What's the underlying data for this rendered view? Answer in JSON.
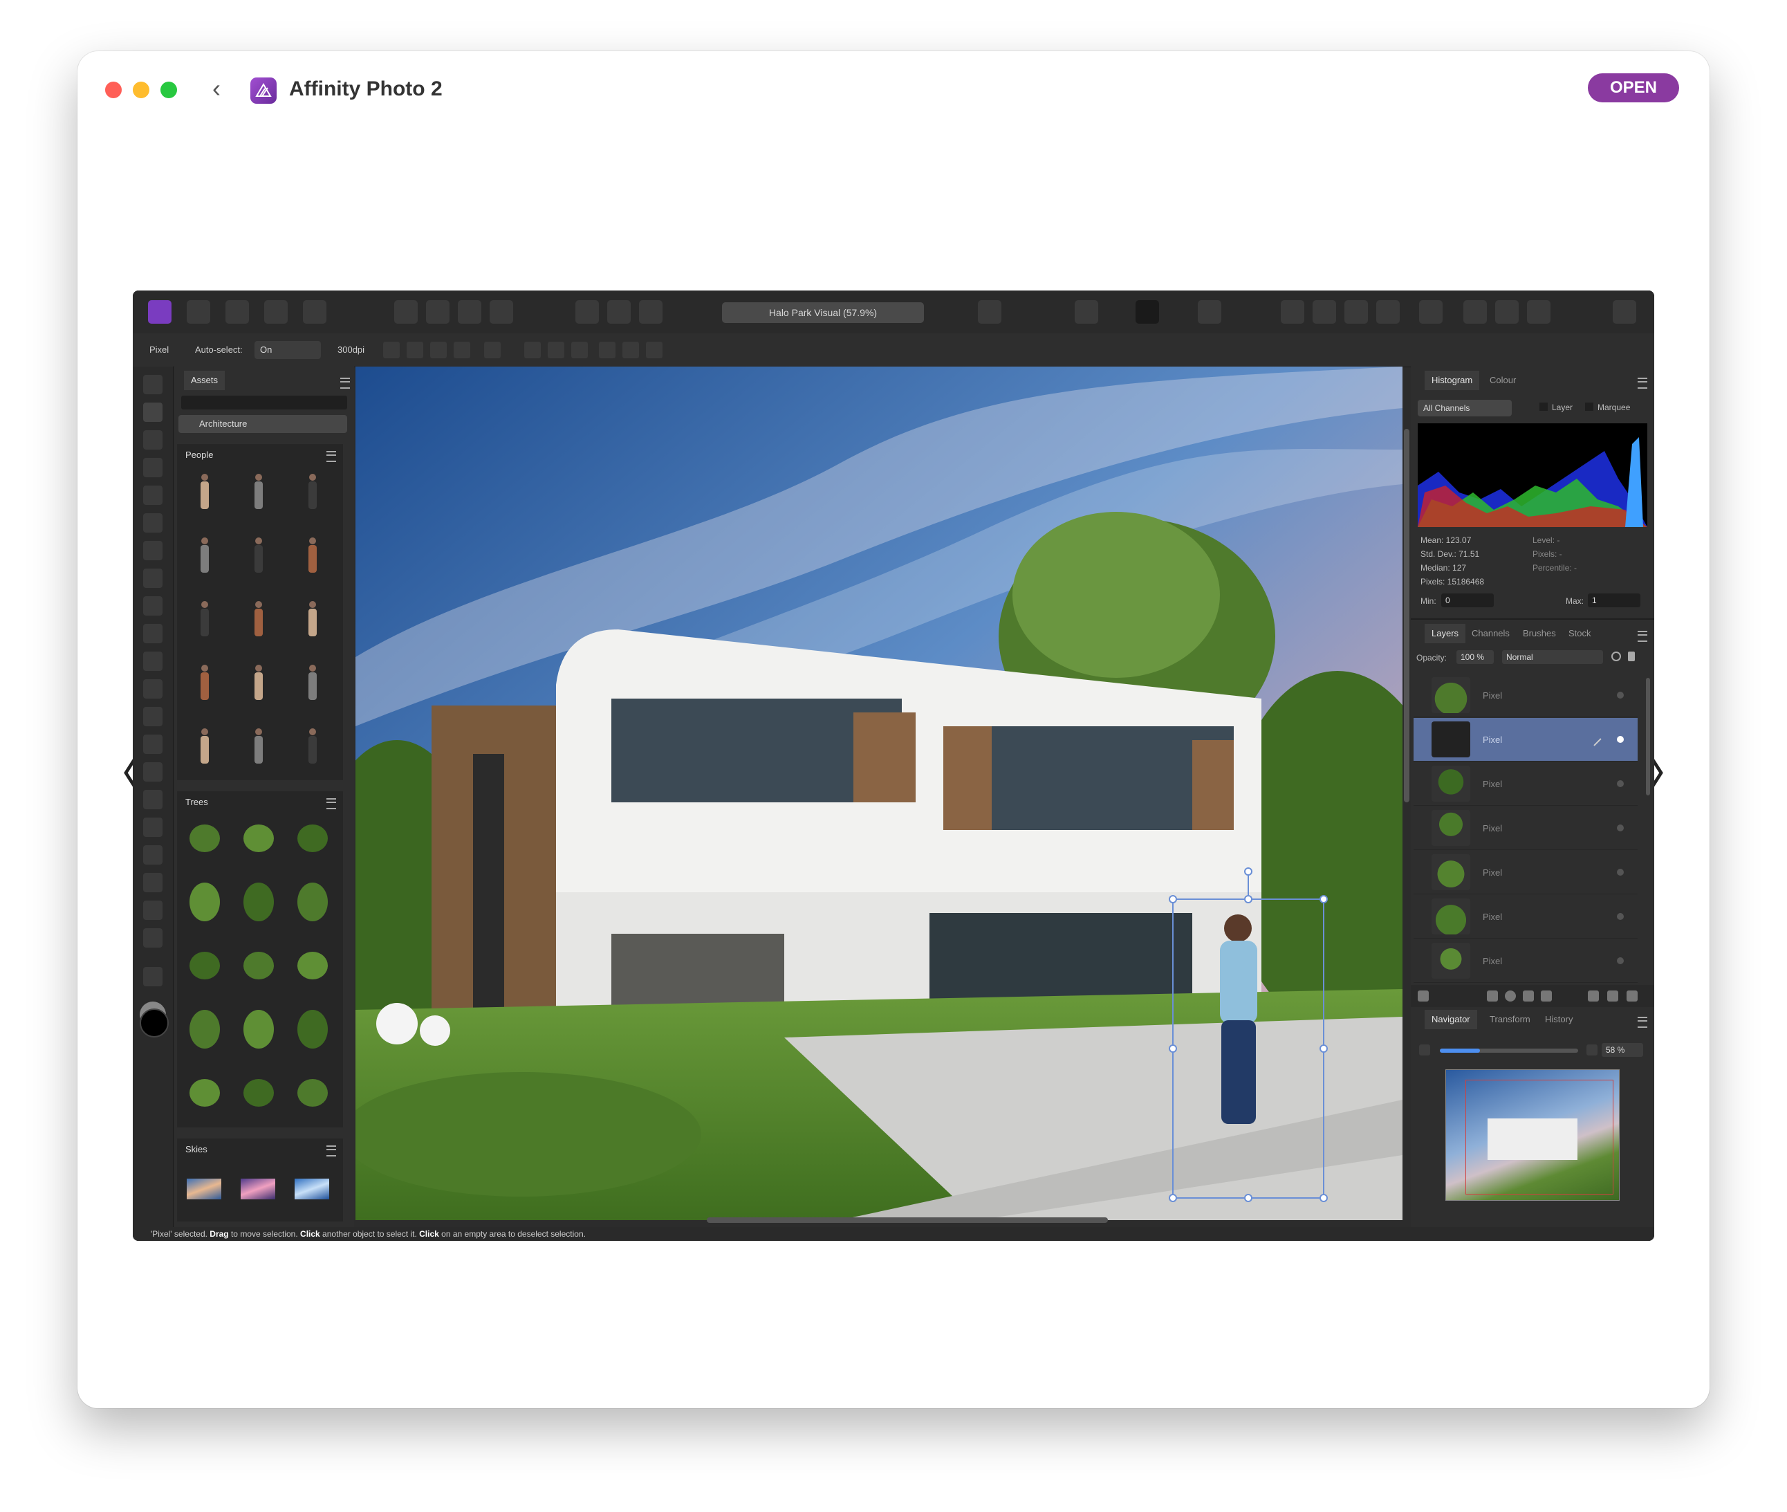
{
  "window": {
    "app_title": "Affinity Photo 2",
    "open_label": "OPEN",
    "prev_arrow": "〈",
    "next_arrow": "〉"
  },
  "app": {
    "document_title": "Halo Park Visual (57.9%)",
    "context": {
      "tool_name": "Pixel",
      "auto_select_label": "Auto-select:",
      "auto_select_value": "On",
      "dpi": "300dpi"
    },
    "assets": {
      "tab_label": "Assets",
      "category": "Architecture",
      "sections": [
        {
          "label": "People"
        },
        {
          "label": "Trees"
        },
        {
          "label": "Skies"
        }
      ]
    },
    "histogram": {
      "tab_histogram": "Histogram",
      "tab_colour": "Colour",
      "channel": "All Channels",
      "layer_label": "Layer",
      "marquee_label": "Marquee",
      "mean": "Mean: 123.07",
      "std_dev": "Std. Dev.: 71.51",
      "median": "Median: 127",
      "pixels": "Pixels: 15186468",
      "level": "Level: -",
      "pixels_right": "Pixels: -",
      "percentile": "Percentile: -",
      "min_label": "Min:",
      "min_value": "0",
      "max_label": "Max:",
      "max_value": "1"
    },
    "layers": {
      "tabs": [
        "Layers",
        "Channels",
        "Brushes",
        "Stock"
      ],
      "opacity_label": "Opacity:",
      "opacity_value": "100 %",
      "blend_mode": "Normal",
      "items": [
        {
          "name": "Pixel"
        },
        {
          "name": "Pixel"
        },
        {
          "name": "Pixel"
        },
        {
          "name": "Pixel"
        },
        {
          "name": "Pixel"
        },
        {
          "name": "Pixel"
        },
        {
          "name": "Pixel"
        }
      ]
    },
    "navigator": {
      "tabs": [
        "Navigator",
        "Transform",
        "History"
      ],
      "zoom": "58 %",
      "zoom_level": 0.58
    },
    "status": {
      "part1": "'Pixel' selected. ",
      "drag": "Drag",
      "part2": " to move selection. ",
      "click1": "Click",
      "part3": " another object to select it. ",
      "click2": "Click",
      "part4": " on an empty area to deselect selection."
    }
  },
  "colors": {
    "brand": "#8a3aa0",
    "panel": "#2e2e2e",
    "selected_layer": "#5a6f9e"
  }
}
